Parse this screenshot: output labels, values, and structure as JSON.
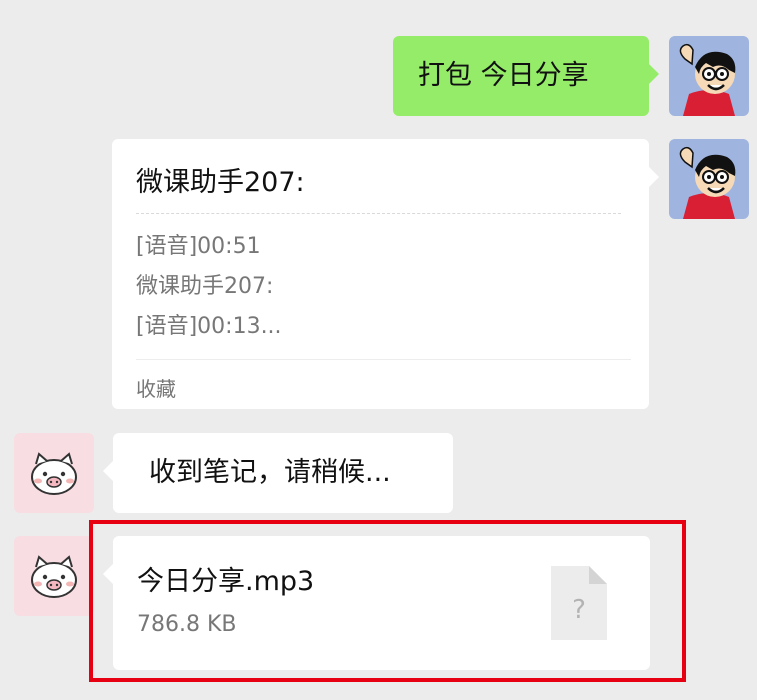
{
  "messages": {
    "packing": {
      "text": "打包 今日分享"
    },
    "record": {
      "title": "微课助手207:",
      "lines": [
        "[语音]00:51",
        "微课助手207:",
        "[语音]00:13..."
      ],
      "footer": "收藏"
    },
    "received": {
      "text": "收到笔记，请稍候..."
    },
    "file": {
      "name": "今日分享.mp3",
      "size": "786.8 KB",
      "icon": "file-unknown-icon",
      "icon_glyph": "?"
    }
  },
  "colors": {
    "background": "#ececec",
    "sent_bubble": "#95ec69",
    "received_bubble": "#ffffff",
    "highlight": "#e60012"
  },
  "icons": {
    "user_avatar": "cartoon-boy-avatar",
    "bot_avatar": "pig-avatar"
  }
}
